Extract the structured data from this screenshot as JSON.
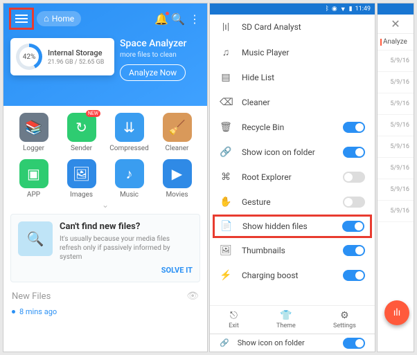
{
  "left": {
    "home_label": "Home",
    "storage": {
      "pct": "42%",
      "title": "Internal Storage",
      "used": "21.96 GB / 52.65 GB"
    },
    "analyzer": {
      "title": "Space Analyzer",
      "sub": "more files to clean",
      "btn": "Analyze Now"
    },
    "tools": [
      {
        "label": "Logger"
      },
      {
        "label": "Sender",
        "new": "NEW"
      },
      {
        "label": "Compressed"
      },
      {
        "label": "Cleaner"
      },
      {
        "label": "APP"
      },
      {
        "label": "Images"
      },
      {
        "label": "Music"
      },
      {
        "label": "Movies"
      }
    ],
    "promo": {
      "h": "Can't find new files?",
      "p": "It's usually because your media files refresh only if passively informed by system",
      "cta": "SOLVE IT"
    },
    "new_files_label": "New Files",
    "new_files_item": "8 mins ago"
  },
  "right": {
    "status_time": "11:49",
    "rows": [
      {
        "icon": "|ı|",
        "label": "SD Card Analyst",
        "toggle": null
      },
      {
        "icon": "♫",
        "label": "Music Player",
        "toggle": null
      },
      {
        "icon": "▤",
        "label": "Hide List",
        "toggle": null
      },
      {
        "icon": "⌫",
        "label": "Cleaner",
        "toggle": null
      },
      {
        "icon": "🗑",
        "label": "Recycle Bin",
        "toggle": true
      },
      {
        "icon": "🔗",
        "label": "Show icon on folder",
        "toggle": true
      },
      {
        "icon": "⌘",
        "label": "Root Explorer",
        "toggle": false
      },
      {
        "icon": "✋",
        "label": "Gesture",
        "toggle": false
      },
      {
        "icon": "📄",
        "label": "Show hidden files",
        "toggle": true,
        "highlight": true
      },
      {
        "icon": "🖼",
        "label": "Thumbnails",
        "toggle": true
      },
      {
        "icon": "⚡",
        "label": "Charging boost",
        "toggle": true
      }
    ],
    "bottom": {
      "exit": "Exit",
      "theme": "Theme",
      "settings": "Settings"
    },
    "strip": {
      "label": "Show icon on folder"
    }
  },
  "peek": {
    "analyze": "Analyze",
    "dates": [
      "5/9/16",
      "5/9/16",
      "5/9/16",
      "5/9/16",
      "5/9/16",
      "5/9/16",
      "5/9/16",
      "5/9/16"
    ]
  }
}
